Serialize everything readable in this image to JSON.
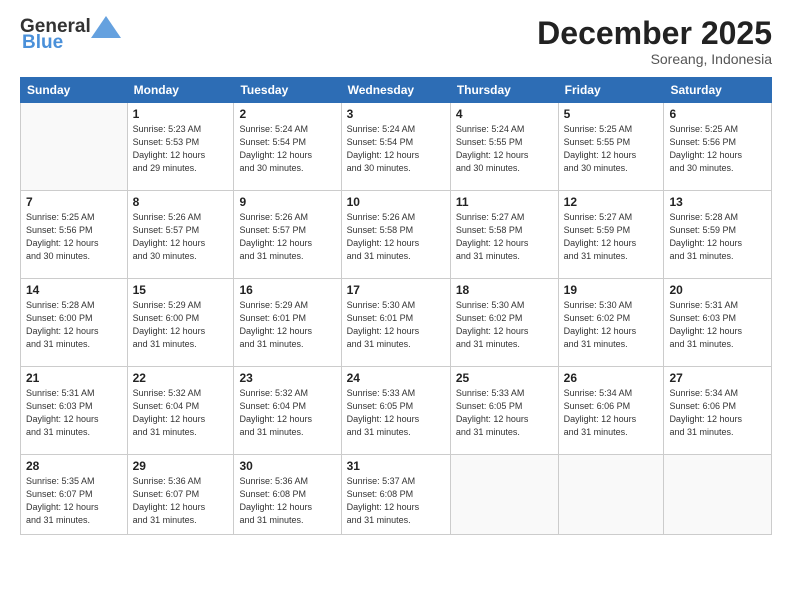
{
  "header": {
    "logo_general": "General",
    "logo_blue": "Blue",
    "month_year": "December 2025",
    "location": "Soreang, Indonesia"
  },
  "weekdays": [
    "Sunday",
    "Monday",
    "Tuesday",
    "Wednesday",
    "Thursday",
    "Friday",
    "Saturday"
  ],
  "weeks": [
    [
      {
        "day": "",
        "info": ""
      },
      {
        "day": "1",
        "info": "Sunrise: 5:23 AM\nSunset: 5:53 PM\nDaylight: 12 hours\nand 29 minutes."
      },
      {
        "day": "2",
        "info": "Sunrise: 5:24 AM\nSunset: 5:54 PM\nDaylight: 12 hours\nand 30 minutes."
      },
      {
        "day": "3",
        "info": "Sunrise: 5:24 AM\nSunset: 5:54 PM\nDaylight: 12 hours\nand 30 minutes."
      },
      {
        "day": "4",
        "info": "Sunrise: 5:24 AM\nSunset: 5:55 PM\nDaylight: 12 hours\nand 30 minutes."
      },
      {
        "day": "5",
        "info": "Sunrise: 5:25 AM\nSunset: 5:55 PM\nDaylight: 12 hours\nand 30 minutes."
      },
      {
        "day": "6",
        "info": "Sunrise: 5:25 AM\nSunset: 5:56 PM\nDaylight: 12 hours\nand 30 minutes."
      }
    ],
    [
      {
        "day": "7",
        "info": "Sunrise: 5:25 AM\nSunset: 5:56 PM\nDaylight: 12 hours\nand 30 minutes."
      },
      {
        "day": "8",
        "info": "Sunrise: 5:26 AM\nSunset: 5:57 PM\nDaylight: 12 hours\nand 30 minutes."
      },
      {
        "day": "9",
        "info": "Sunrise: 5:26 AM\nSunset: 5:57 PM\nDaylight: 12 hours\nand 31 minutes."
      },
      {
        "day": "10",
        "info": "Sunrise: 5:26 AM\nSunset: 5:58 PM\nDaylight: 12 hours\nand 31 minutes."
      },
      {
        "day": "11",
        "info": "Sunrise: 5:27 AM\nSunset: 5:58 PM\nDaylight: 12 hours\nand 31 minutes."
      },
      {
        "day": "12",
        "info": "Sunrise: 5:27 AM\nSunset: 5:59 PM\nDaylight: 12 hours\nand 31 minutes."
      },
      {
        "day": "13",
        "info": "Sunrise: 5:28 AM\nSunset: 5:59 PM\nDaylight: 12 hours\nand 31 minutes."
      }
    ],
    [
      {
        "day": "14",
        "info": "Sunrise: 5:28 AM\nSunset: 6:00 PM\nDaylight: 12 hours\nand 31 minutes."
      },
      {
        "day": "15",
        "info": "Sunrise: 5:29 AM\nSunset: 6:00 PM\nDaylight: 12 hours\nand 31 minutes."
      },
      {
        "day": "16",
        "info": "Sunrise: 5:29 AM\nSunset: 6:01 PM\nDaylight: 12 hours\nand 31 minutes."
      },
      {
        "day": "17",
        "info": "Sunrise: 5:30 AM\nSunset: 6:01 PM\nDaylight: 12 hours\nand 31 minutes."
      },
      {
        "day": "18",
        "info": "Sunrise: 5:30 AM\nSunset: 6:02 PM\nDaylight: 12 hours\nand 31 minutes."
      },
      {
        "day": "19",
        "info": "Sunrise: 5:30 AM\nSunset: 6:02 PM\nDaylight: 12 hours\nand 31 minutes."
      },
      {
        "day": "20",
        "info": "Sunrise: 5:31 AM\nSunset: 6:03 PM\nDaylight: 12 hours\nand 31 minutes."
      }
    ],
    [
      {
        "day": "21",
        "info": "Sunrise: 5:31 AM\nSunset: 6:03 PM\nDaylight: 12 hours\nand 31 minutes."
      },
      {
        "day": "22",
        "info": "Sunrise: 5:32 AM\nSunset: 6:04 PM\nDaylight: 12 hours\nand 31 minutes."
      },
      {
        "day": "23",
        "info": "Sunrise: 5:32 AM\nSunset: 6:04 PM\nDaylight: 12 hours\nand 31 minutes."
      },
      {
        "day": "24",
        "info": "Sunrise: 5:33 AM\nSunset: 6:05 PM\nDaylight: 12 hours\nand 31 minutes."
      },
      {
        "day": "25",
        "info": "Sunrise: 5:33 AM\nSunset: 6:05 PM\nDaylight: 12 hours\nand 31 minutes."
      },
      {
        "day": "26",
        "info": "Sunrise: 5:34 AM\nSunset: 6:06 PM\nDaylight: 12 hours\nand 31 minutes."
      },
      {
        "day": "27",
        "info": "Sunrise: 5:34 AM\nSunset: 6:06 PM\nDaylight: 12 hours\nand 31 minutes."
      }
    ],
    [
      {
        "day": "28",
        "info": "Sunrise: 5:35 AM\nSunset: 6:07 PM\nDaylight: 12 hours\nand 31 minutes."
      },
      {
        "day": "29",
        "info": "Sunrise: 5:36 AM\nSunset: 6:07 PM\nDaylight: 12 hours\nand 31 minutes."
      },
      {
        "day": "30",
        "info": "Sunrise: 5:36 AM\nSunset: 6:08 PM\nDaylight: 12 hours\nand 31 minutes."
      },
      {
        "day": "31",
        "info": "Sunrise: 5:37 AM\nSunset: 6:08 PM\nDaylight: 12 hours\nand 31 minutes."
      },
      {
        "day": "",
        "info": ""
      },
      {
        "day": "",
        "info": ""
      },
      {
        "day": "",
        "info": ""
      }
    ]
  ]
}
